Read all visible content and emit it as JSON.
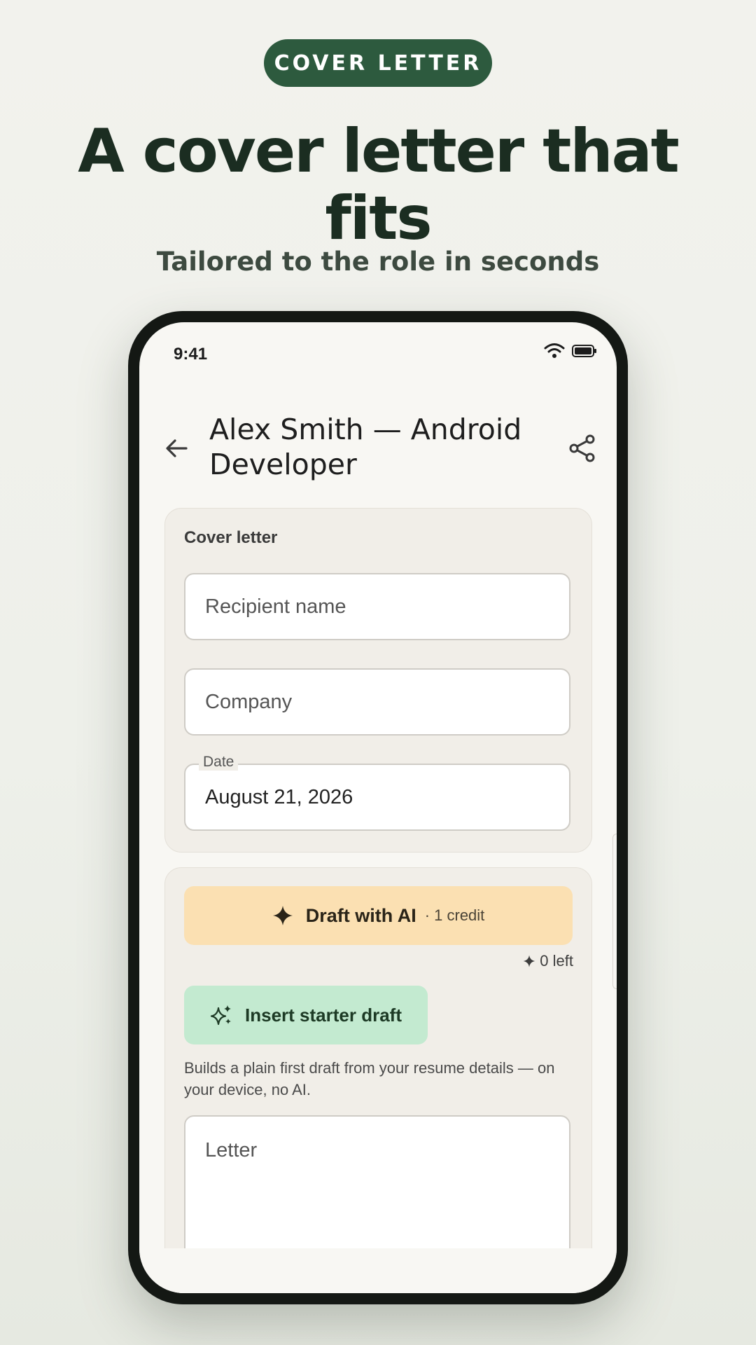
{
  "promo": {
    "badge": "COVER LETTER",
    "headline": "A cover letter that fits",
    "subheadline": "Tailored to the role in seconds"
  },
  "status_bar": {
    "time": "9:41",
    "icons": [
      "wifi-icon",
      "battery-icon"
    ]
  },
  "app_bar": {
    "title": "Alex Smith — Android Developer",
    "back_icon": "arrow-back-icon",
    "share_icon": "share-icon"
  },
  "cover_letter_card": {
    "label": "Cover letter",
    "recipient_placeholder": "Recipient name",
    "company_placeholder": "Company",
    "date_label": "Date",
    "date_value": "August 21, 2026"
  },
  "draft_card": {
    "ai_button_label": "Draft with AI",
    "ai_button_cost": "· 1 credit",
    "credits_left": "0 left",
    "starter_button_label": "Insert starter draft",
    "starter_hint": "Builds a plain first draft from your resume details — on your device, no AI.",
    "letter_placeholder": "Letter"
  },
  "colors": {
    "badge_bg": "#2d5a3e",
    "headline": "#1b2d21",
    "ai_button_bg": "#fbe0b2",
    "starter_button_bg": "#c3ead0",
    "phone_frame": "#141814"
  }
}
